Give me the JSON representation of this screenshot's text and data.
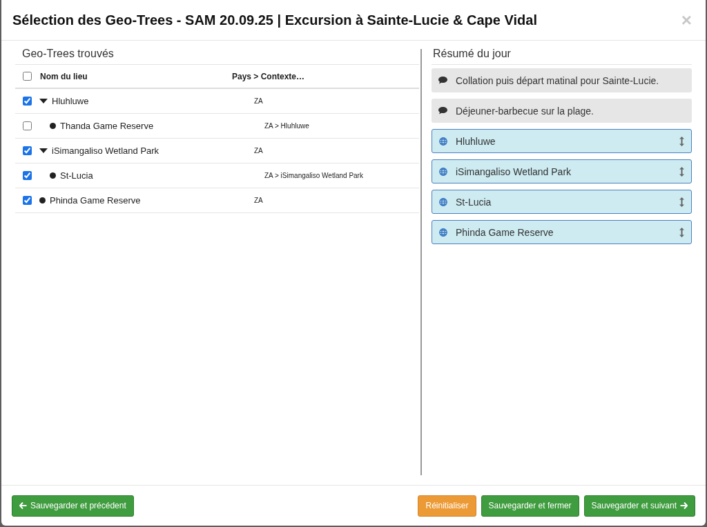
{
  "modal": {
    "title": "Sélection des Geo-Trees - SAM 20.09.25 | Excursion à Sainte-Lucie & Cape Vidal",
    "close_label": "×"
  },
  "found": {
    "title": "Geo-Trees trouvés",
    "columns": [
      "Nom du lieu",
      "Pays > Contexte…"
    ],
    "all_checked": false,
    "rows": [
      {
        "name": "Hluhluwe",
        "context": "ZA",
        "checked": true,
        "expanded": true,
        "children": [
          {
            "name": "Thanda Game Reserve",
            "context": "ZA > Hluhluwe",
            "checked": false
          }
        ]
      },
      {
        "name": "iSimangaliso Wetland Park",
        "context": "ZA",
        "checked": true,
        "expanded": true,
        "children": [
          {
            "name": "St-Lucia",
            "context": "ZA > iSimangaliso Wetland Park",
            "checked": true
          }
        ]
      },
      {
        "name": "Phinda Game Reserve",
        "context": "ZA",
        "checked": true
      }
    ]
  },
  "summary": {
    "title": "Résumé du jour",
    "items": [
      {
        "kind": "note",
        "text": "Collation puis départ matinal pour Sainte-Lucie."
      },
      {
        "kind": "note",
        "text": "Déjeuner-barbecue sur la plage."
      },
      {
        "kind": "place",
        "text": "Hluhluwe"
      },
      {
        "kind": "place",
        "text": "iSimangaliso Wetland Park"
      },
      {
        "kind": "place",
        "text": "St-Lucia"
      },
      {
        "kind": "place",
        "text": "Phinda Game Reserve"
      }
    ]
  },
  "footer": {
    "buttons": [
      {
        "label": "Sauvegarder et précédent",
        "kind": "back"
      },
      {
        "label": "Réinitialiser",
        "kind": "reset"
      },
      {
        "label": "Sauvegarder et fermer",
        "kind": "save"
      },
      {
        "label": "Sauvegarder et suivant",
        "kind": "next"
      }
    ]
  }
}
